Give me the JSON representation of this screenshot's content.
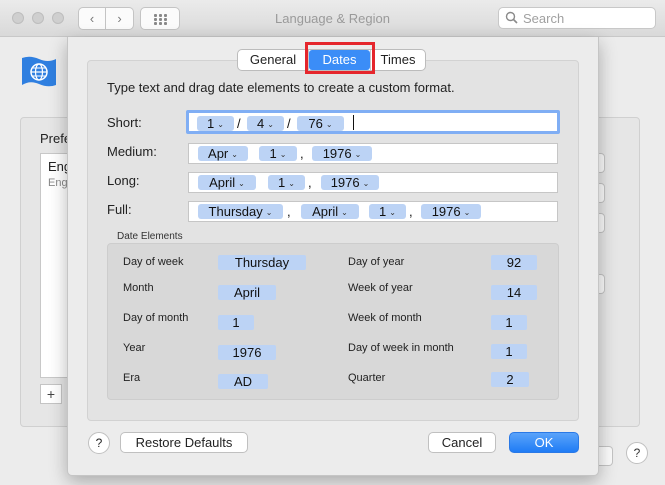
{
  "window": {
    "title": "Language & Region",
    "search_placeholder": "Search"
  },
  "background": {
    "preferred_label": "Prefe",
    "list_item_1": "Eng",
    "list_item_2": "Eng",
    "add_label": "+",
    "help_label": "?"
  },
  "tabs": {
    "general": "General",
    "dates": "Dates",
    "times": "Times",
    "selected": "Dates"
  },
  "instruction": "Type text and drag date elements to create a custom format.",
  "formats": {
    "short": {
      "label": "Short:",
      "tokens": [
        "1",
        "4",
        "76"
      ],
      "seps": [
        "/",
        "/"
      ]
    },
    "medium": {
      "label": "Medium:",
      "tokens": [
        "Apr",
        "1",
        "1976"
      ],
      "seps": [
        ","
      ]
    },
    "long": {
      "label": "Long:",
      "tokens": [
        "April",
        "1",
        "1976"
      ],
      "seps": [
        ","
      ]
    },
    "full": {
      "label": "Full:",
      "tokens": [
        "Thursday",
        "April",
        "1",
        "1976"
      ],
      "seps": [
        ",",
        ","
      ]
    }
  },
  "date_elements": {
    "group_label": "Date Elements",
    "left": [
      {
        "label": "Day of week",
        "value": "Thursday"
      },
      {
        "label": "Month",
        "value": "April"
      },
      {
        "label": "Day of month",
        "value": "1"
      },
      {
        "label": "Year",
        "value": "1976"
      },
      {
        "label": "Era",
        "value": "AD"
      }
    ],
    "right": [
      {
        "label": "Day of year",
        "value": "92"
      },
      {
        "label": "Week of year",
        "value": "14"
      },
      {
        "label": "Week of month",
        "value": "1"
      },
      {
        "label": "Day of week in month",
        "value": "1"
      },
      {
        "label": "Quarter",
        "value": "2"
      }
    ]
  },
  "buttons": {
    "help": "?",
    "restore_defaults": "Restore Defaults",
    "cancel": "Cancel",
    "ok": "OK"
  },
  "colors": {
    "accent": "#3b8df7",
    "token": "#bcd3f5",
    "highlight": "#e5262c"
  }
}
